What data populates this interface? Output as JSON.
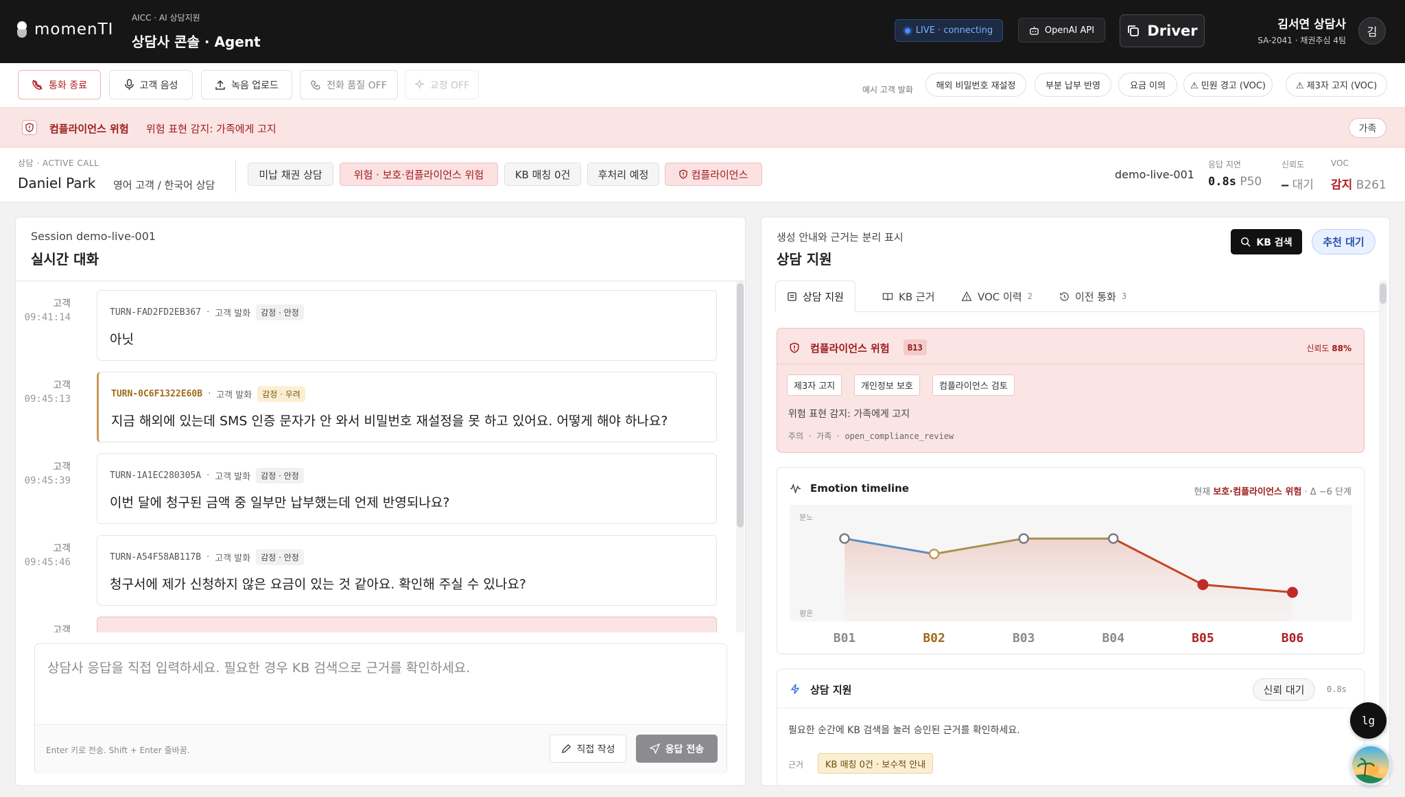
{
  "header": {
    "logo": "momenTI",
    "app_sub": "AICC · AI 상담지원",
    "app_title": "상담사 콘솔 · Agent",
    "live_status": "LIVE · connecting",
    "api_label": "OpenAI API",
    "driver_label": "Driver",
    "agent_name": "김서연 상담사",
    "agent_meta": "SA-2041 · 채권추심 4팀",
    "avatar": "김"
  },
  "toolbar": {
    "end_call": "통화 종료",
    "customer_voice": "고객 음성",
    "upload_recording": "녹음 업로드",
    "phone_quality": "전화 품질 OFF",
    "correction": "교정 OFF",
    "examples_label": "예시 고객 발화",
    "examples": [
      "해외 비밀번호 재설정",
      "부분 납부 반영",
      "요금 이의",
      "⚠ 민원 경고 (VOC)",
      "⚠ 제3자 고지 (VOC)"
    ]
  },
  "alert": {
    "title": "컴플라이언스 위험",
    "text": "위험 표현 감지: 가족에게 고지",
    "chip": "가족"
  },
  "call": {
    "label": "상담 · ACTIVE CALL",
    "customer": "Daniel Park",
    "language": "영어 고객 / 한국어 상담",
    "tags": [
      "미납 채권 상담",
      "위험 · 보호·컴플라이언스 위험",
      "KB 매칭 0건",
      "후처리 예정",
      "컴플라이언스"
    ],
    "session": "demo-live-001",
    "latency_label": "응답 지연",
    "latency_value": "0.8s",
    "latency_unit": "P50",
    "confidence_label": "신뢰도",
    "confidence_value": "—",
    "confidence_state": "대기",
    "voc_label": "VOC",
    "voc_value": "감지",
    "voc_code": "B261"
  },
  "left": {
    "session_title": "Session demo-live-001",
    "title": "실시간 대화",
    "turns": [
      {
        "who": "고객",
        "time": "09:41:14",
        "id": "TURN-FAD2FD2EB367",
        "kind": "고객 발화",
        "emotion": "감정 · 안정",
        "text": "아닛"
      },
      {
        "who": "고객",
        "time": "09:45:13",
        "id": "TURN-0C6F1322E60B",
        "kind": "고객 발화",
        "emotion": "감정 · 우려",
        "text": "지금 해외에 있는데 SMS 인증 문자가 안 와서 비밀번호 재설정을 못 하고 있어요. 어떻게 해야 하나요?"
      },
      {
        "who": "고객",
        "time": "09:45:39",
        "id": "TURN-1A1EC280305A",
        "kind": "고객 발화",
        "emotion": "감정 · 안정",
        "text": "이번 달에 청구된 금액 중 일부만 납부했는데 언제 반영되나요?"
      },
      {
        "who": "고객",
        "time": "09:45:46",
        "id": "TURN-A54F58AB117B",
        "kind": "고객 발화",
        "emotion": "감정 · 안정",
        "text": "청구서에 제가 신청하지 않은 요금이 있는 것 같아요. 확인해 주실 수 있나요?"
      },
      {
        "who": "고객",
        "time": "",
        "id": "",
        "kind": "",
        "emotion": "",
        "text": ""
      }
    ],
    "composer_placeholder": "상담사 응답을 직접 입력하세요. 필요한 경우 KB 검색으로 근거를 확인하세요.",
    "composer_hint": "Enter 키로 전송. Shift + Enter 줄바꿈.",
    "write_label": "직접 작성",
    "send_label": "응답 전송"
  },
  "right": {
    "sub": "생성 안내와 근거는 분리 표시",
    "title": "상담 지원",
    "kb_search": "KB 검색",
    "recommend": "추천 대기",
    "tabs": [
      {
        "label": "상담 지원",
        "count": ""
      },
      {
        "label": "KB 근거",
        "count": ""
      },
      {
        "label": "VOC 이력",
        "count": "2"
      },
      {
        "label": "이전 통화",
        "count": "3"
      }
    ],
    "compliance": {
      "title": "컴플라이언스 위험",
      "code": "B13",
      "confidence_label": "신뢰도",
      "confidence": "88%",
      "tags": [
        "제3자 고지",
        "개인정보 보호",
        "컴플라이언스 검토"
      ],
      "description": "위험 표현 감지: 가족에게 고지",
      "foot_level": "주의",
      "foot_keyword": "가족",
      "foot_code": "open_compliance_review"
    },
    "emotion": {
      "title": "Emotion timeline",
      "current_label": "현재",
      "current_value": "보호·컴플라이언스 위험",
      "delta": "· Δ −6 단계"
    },
    "assist": {
      "title": "상담 지원",
      "chip": "신뢰 대기",
      "latency": "0.8s",
      "text": "필요한 순간에 KB 검색을 눌러 승인된 근거를 확인하세요.",
      "evidence_label": "근거",
      "evidence": "KB 매칭 0건 · 보수적 안내"
    }
  },
  "floating": {
    "lg": "lg"
  },
  "colors": {
    "accent_red": "#b01e1e",
    "alert_bg": "#fbe4e4",
    "blue": "#4b8bff",
    "amber": "#c69a55"
  },
  "chart_data": {
    "type": "line",
    "categories": [
      "B01",
      "B02",
      "B03",
      "B04",
      "B05",
      "B06"
    ],
    "y_top_label": "분노",
    "y_bottom_label": "평온",
    "series": [
      {
        "values": [
          0.9,
          0.7,
          0.9,
          0.9,
          0.3,
          0.2
        ],
        "states": [
          "neutral",
          "worry",
          "neutral",
          "neutral",
          "risk",
          "risk"
        ]
      }
    ],
    "ylim": [
      0,
      1
    ],
    "grid": false,
    "legend": "none"
  }
}
